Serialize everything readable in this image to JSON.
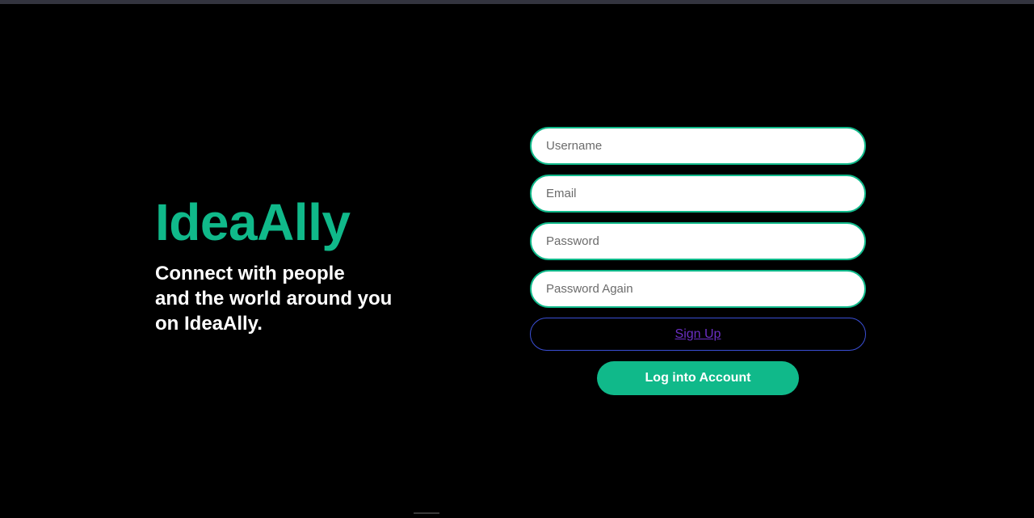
{
  "app": {
    "name": "IdeaAlly",
    "tagline": "Connect with people\nand the world around you\non IdeaAlly."
  },
  "form": {
    "username_placeholder": "Username",
    "email_placeholder": "Email",
    "password_placeholder": "Password",
    "password_again_placeholder": "Password Again",
    "signup_label": "Sign Up",
    "login_label": "Log into Account"
  },
  "colors": {
    "background": "#000000",
    "accent": "#10b98a",
    "link": "#6a2ec2",
    "signup_border": "#3b4fd6"
  }
}
